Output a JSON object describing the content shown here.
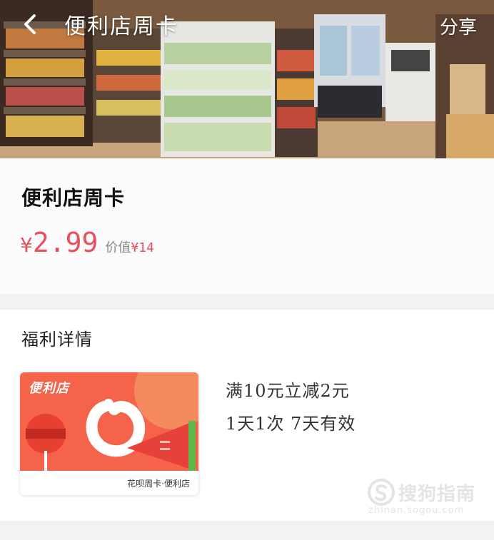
{
  "nav": {
    "title": "便利店周卡",
    "share_label": "分享",
    "back_icon": "chevron-left-icon"
  },
  "product": {
    "title": "便利店周卡",
    "price_symbol": "¥",
    "price": "2.99",
    "original_label": "价值",
    "original_price": "¥14"
  },
  "benefits": {
    "heading": "福利详情",
    "card_brand": "便利店",
    "card_caption": "花呗周卡·便利店",
    "lines": [
      "满10元立减2元",
      "1天1次  7天有效"
    ]
  },
  "watermark": {
    "text": "搜狗指南",
    "url": "zhinan.sogou.com"
  },
  "colors": {
    "price": "#e8505b",
    "card_orange": "#f4634a",
    "background": "#f2f2f2"
  }
}
